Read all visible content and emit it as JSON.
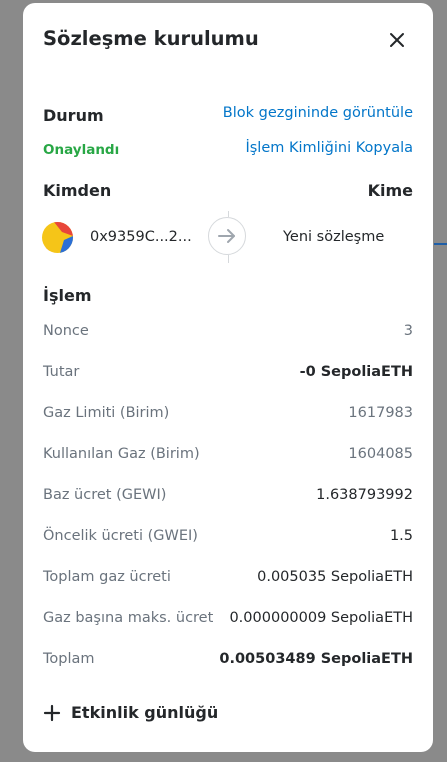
{
  "dialog": {
    "title": "Sözleşme kurulumu",
    "close_icon": "close-icon"
  },
  "status": {
    "label": "Durum",
    "value": "Onaylandı",
    "value_color": "#28a745",
    "explorer_link": "Blok gezgininde görüntüle",
    "copy_tx_link": "İşlem Kimliğini Kopyala",
    "link_color": "#0376c9"
  },
  "parties": {
    "from_label": "Kimden",
    "to_label": "Kime",
    "from_address": "0x9359C...2...",
    "to_value": "Yeni sözleşme",
    "arrow_icon": "arrow-right-icon"
  },
  "transaction": {
    "heading": "İşlem",
    "rows": [
      {
        "label": "Nonce",
        "value": "3"
      },
      {
        "label": "Tutar",
        "value": "-0 SepoliaETH"
      },
      {
        "label": "Gaz Limiti (Birim)",
        "value": "1617983"
      },
      {
        "label": "Kullanılan Gaz (Birim)",
        "value": "1604085"
      },
      {
        "label": "Baz ücret (GEWI)",
        "value": "1.638793992"
      },
      {
        "label": "Öncelik ücreti (GWEI)",
        "value": "1.5"
      },
      {
        "label": "Toplam gaz ücreti",
        "value": "0.005035 SepoliaETH"
      },
      {
        "label": "Gaz başına maks. ücret",
        "value": "0.000000009 SepoliaETH"
      },
      {
        "label": "Toplam",
        "value": "0.00503489 SepoliaETH"
      }
    ]
  },
  "activity": {
    "label": "Etkinlik günlüğü",
    "icon": "plus-icon"
  }
}
